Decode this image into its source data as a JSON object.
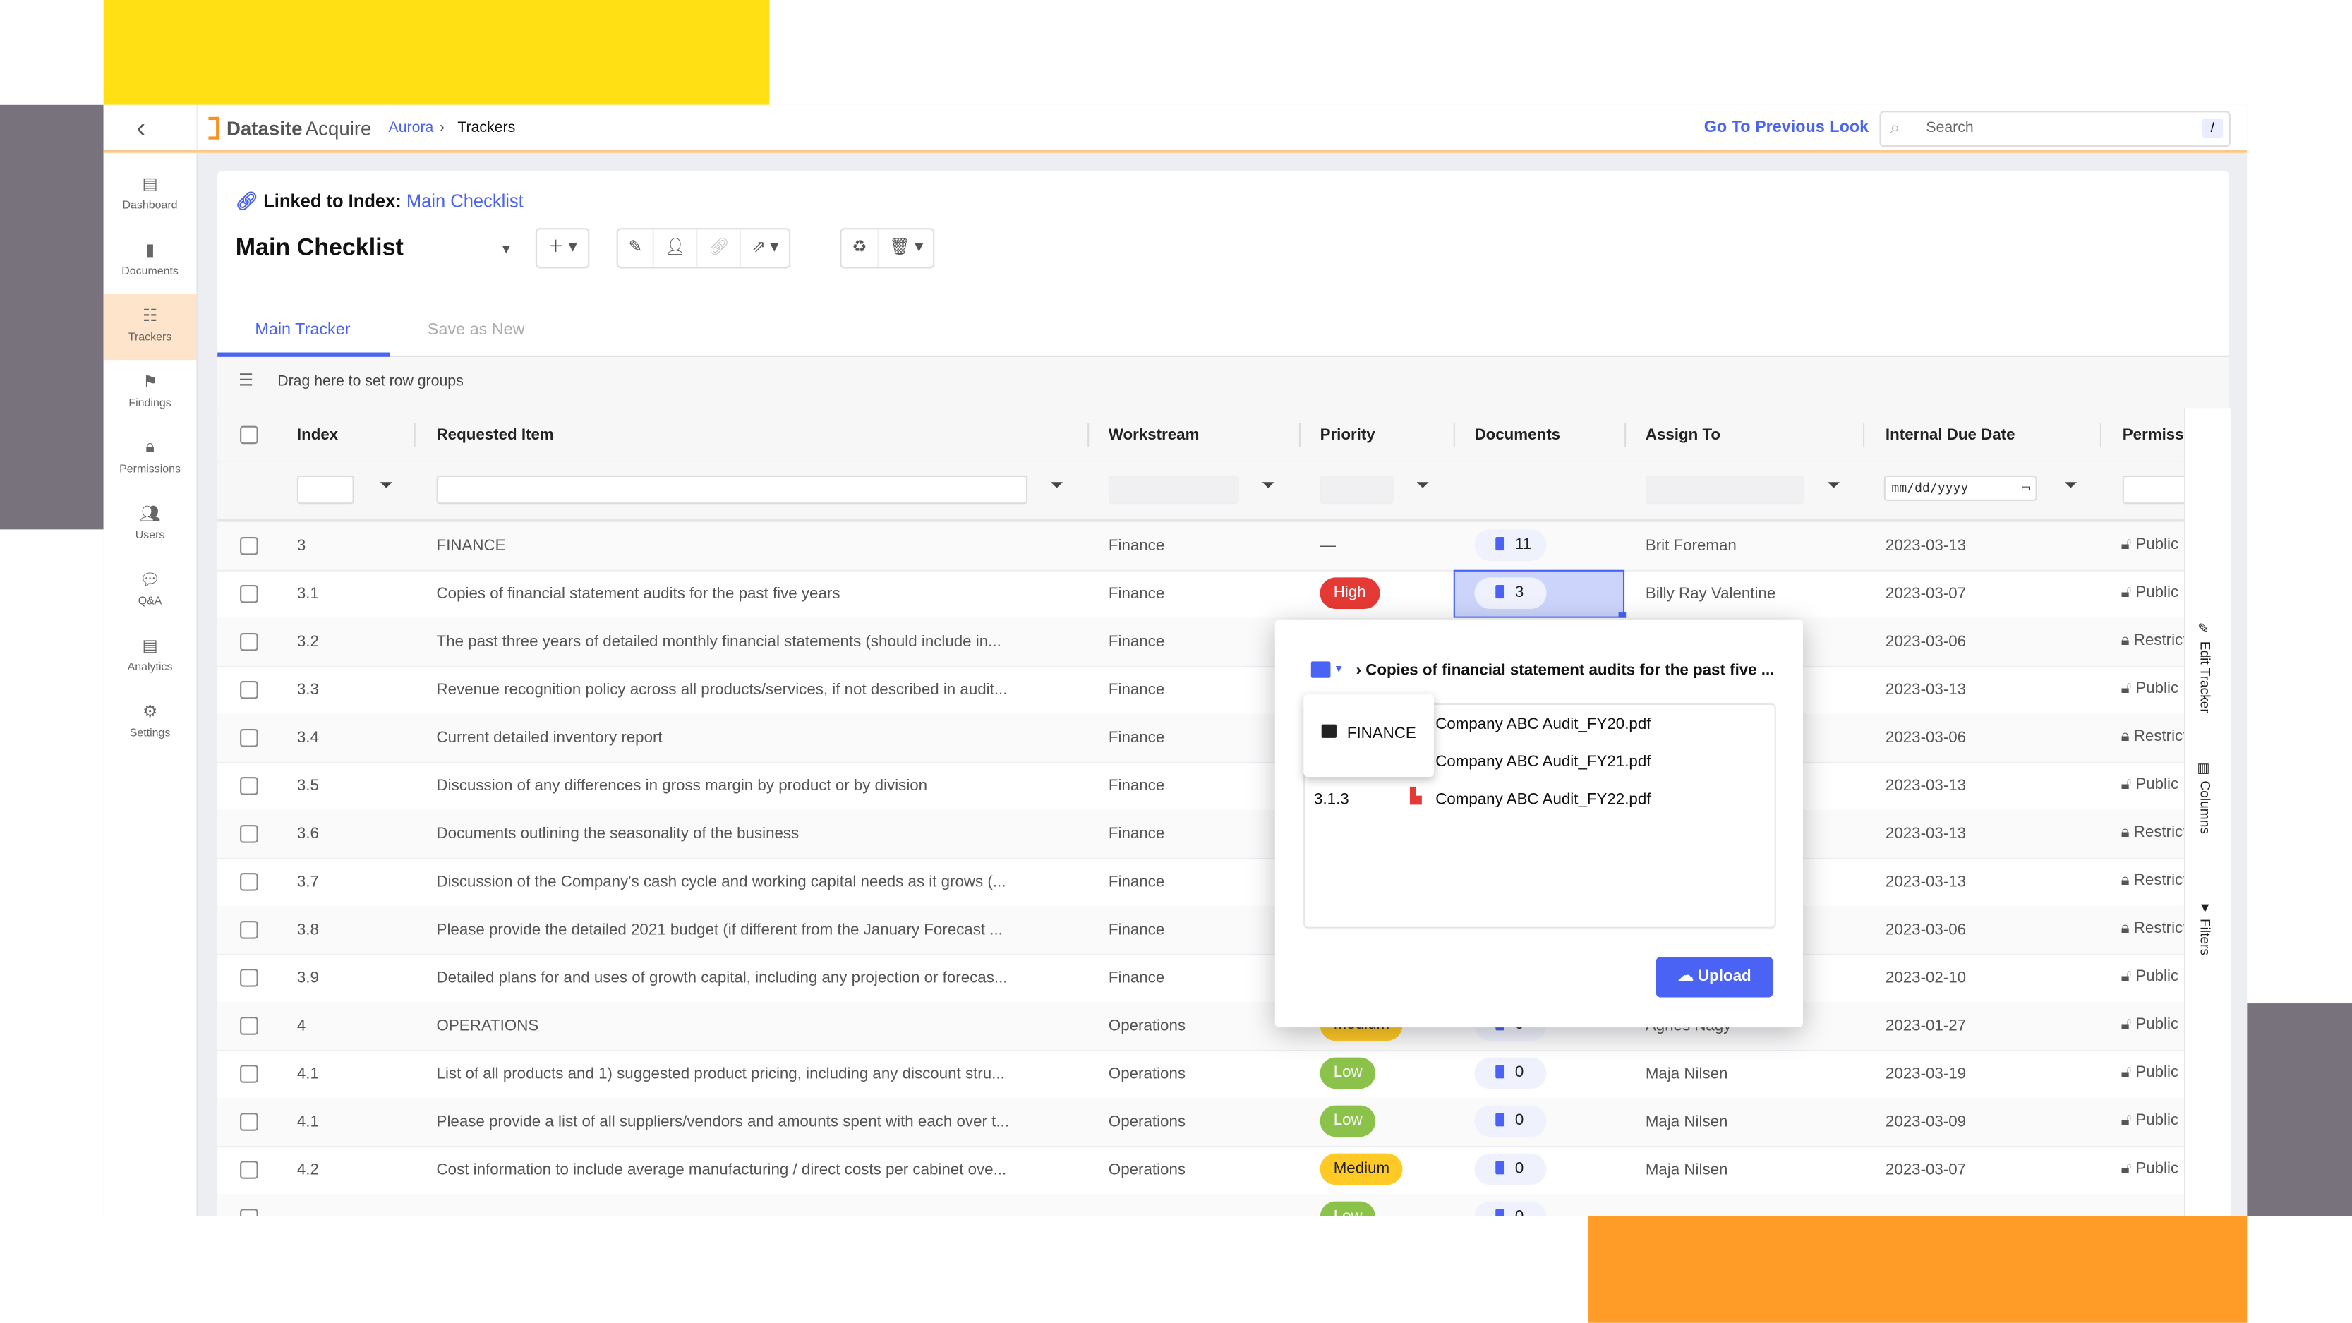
{
  "topbar": {
    "brand": "Datasite",
    "product": "Acquire",
    "breadcrumb": [
      "Aurora",
      "Trackers"
    ],
    "go_previous": "Go To Previous Look",
    "search_placeholder": "Search",
    "search_shortcut": "/"
  },
  "sidebar": {
    "items": [
      {
        "label": "Dashboard",
        "icon": "dashboard-icon",
        "glyph": "▤"
      },
      {
        "label": "Documents",
        "icon": "document-icon",
        "glyph": "▮"
      },
      {
        "label": "Trackers",
        "icon": "checklist-icon",
        "glyph": "☷",
        "active": true
      },
      {
        "label": "Findings",
        "icon": "flag-icon",
        "glyph": "⚑"
      },
      {
        "label": "Permissions",
        "icon": "lock-icon",
        "glyph": "🔒︎"
      },
      {
        "label": "Users",
        "icon": "users-icon",
        "glyph": "👥︎"
      },
      {
        "label": "Q&A",
        "icon": "chat-icon",
        "glyph": "💬︎"
      },
      {
        "label": "Analytics",
        "icon": "analytics-icon",
        "glyph": "▤"
      },
      {
        "label": "Settings",
        "icon": "gear-icon",
        "glyph": "⚙"
      }
    ]
  },
  "header": {
    "linked_label": "Linked to Index:",
    "linked_index": "Main Checklist",
    "tracker_title": "Main Checklist"
  },
  "tabs": [
    {
      "label": "Main Tracker",
      "active": true
    },
    {
      "label": "Save as New",
      "active": false
    }
  ],
  "group_bar": "Drag here to set row groups",
  "columns": [
    "Index",
    "Requested Item",
    "Workstream",
    "Priority",
    "Documents",
    "Assign To",
    "Internal Due Date",
    "Permiss"
  ],
  "date_filter_placeholder": "mm/dd/yyyy",
  "side_panel": [
    "Edit Tracker",
    "Columns",
    "Filters"
  ],
  "colors": {
    "accent": "#4a63f5",
    "high": "#e53935",
    "medium": "#ffc926",
    "low": "#8bc34a",
    "brand_orange": "#f7931e"
  },
  "rows": [
    {
      "index": "3",
      "item": "FINANCE",
      "workstream": "Finance",
      "priority": "—",
      "docs": "11",
      "assign": "Brit Foreman",
      "due": "2023-03-13",
      "perm": "Public"
    },
    {
      "index": "3.1",
      "item": "Copies of financial statement audits for the past five years",
      "workstream": "Finance",
      "priority": "High",
      "docs": "3",
      "assign": "Billy Ray Valentine",
      "due": "2023-03-07",
      "perm": "Public",
      "selected": true
    },
    {
      "index": "3.2",
      "item": "The past three years of detailed monthly financial statements (should include in...",
      "workstream": "Finance",
      "due": "2023-03-06",
      "perm": "Restricted"
    },
    {
      "index": "3.3",
      "item": "Revenue recognition policy across all products/services, if not described in audit...",
      "workstream": "Finance",
      "due": "2023-03-13",
      "perm": "Public"
    },
    {
      "index": "3.4",
      "item": "Current detailed inventory report",
      "workstream": "Finance",
      "due": "2023-03-06",
      "perm": "Restricted"
    },
    {
      "index": "3.5",
      "item": "Discussion of any differences in gross margin by product or by division",
      "workstream": "Finance",
      "due": "2023-03-13",
      "perm": "Public"
    },
    {
      "index": "3.6",
      "item": "Documents outlining the seasonality of the business",
      "workstream": "Finance",
      "due": "2023-03-13",
      "perm": "Restricted"
    },
    {
      "index": "3.7",
      "item": "Discussion of the Company's cash cycle and working capital needs as it grows (...",
      "workstream": "Finance",
      "due": "2023-03-13",
      "perm": "Restricted"
    },
    {
      "index": "3.8",
      "item": "Please provide the detailed 2021 budget (if different from the January Forecast ...",
      "workstream": "Finance",
      "due": "2023-03-06",
      "perm": "Restricted"
    },
    {
      "index": "3.9",
      "item": "Detailed plans for and uses of growth capital, including any projection or forecas...",
      "workstream": "Finance",
      "due": "2023-02-10",
      "perm": "Public"
    },
    {
      "index": "4",
      "item": "OPERATIONS",
      "workstream": "Operations",
      "priority": "Medium",
      "docs": "0",
      "assign": "Agnes Nagy",
      "due": "2023-01-27",
      "perm": "Public"
    },
    {
      "index": "4.1",
      "item": "List of all products and 1) suggested product pricing, including any discount stru...",
      "workstream": "Operations",
      "priority": "Low",
      "docs": "0",
      "assign": "Maja Nilsen",
      "due": "2023-03-19",
      "perm": "Public"
    },
    {
      "index": "4.1",
      "item": "Please provide a list of all suppliers/vendors and amounts spent with each over t...",
      "workstream": "Operations",
      "priority": "Low",
      "docs": "0",
      "assign": "Maja Nilsen",
      "due": "2023-03-09",
      "perm": "Public"
    },
    {
      "index": "4.2",
      "item": "Cost information to include average manufacturing / direct costs per cabinet ove...",
      "workstream": "Operations",
      "priority": "Medium",
      "docs": "0",
      "assign": "Maja Nilsen",
      "due": "2023-03-07",
      "perm": "Public"
    },
    {
      "priority": "Low",
      "docs": "0"
    }
  ],
  "popup": {
    "path_title": "Copies of financial statement audits for the past five ...",
    "folder_option": "FINANCE",
    "files": [
      {
        "index": "",
        "name": "Company ABC Audit_FY20.pdf"
      },
      {
        "index": "",
        "name": "Company ABC Audit_FY21.pdf"
      },
      {
        "index": "3.1.3",
        "name": "Company ABC Audit_FY22.pdf"
      }
    ],
    "upload_label": "Upload"
  }
}
